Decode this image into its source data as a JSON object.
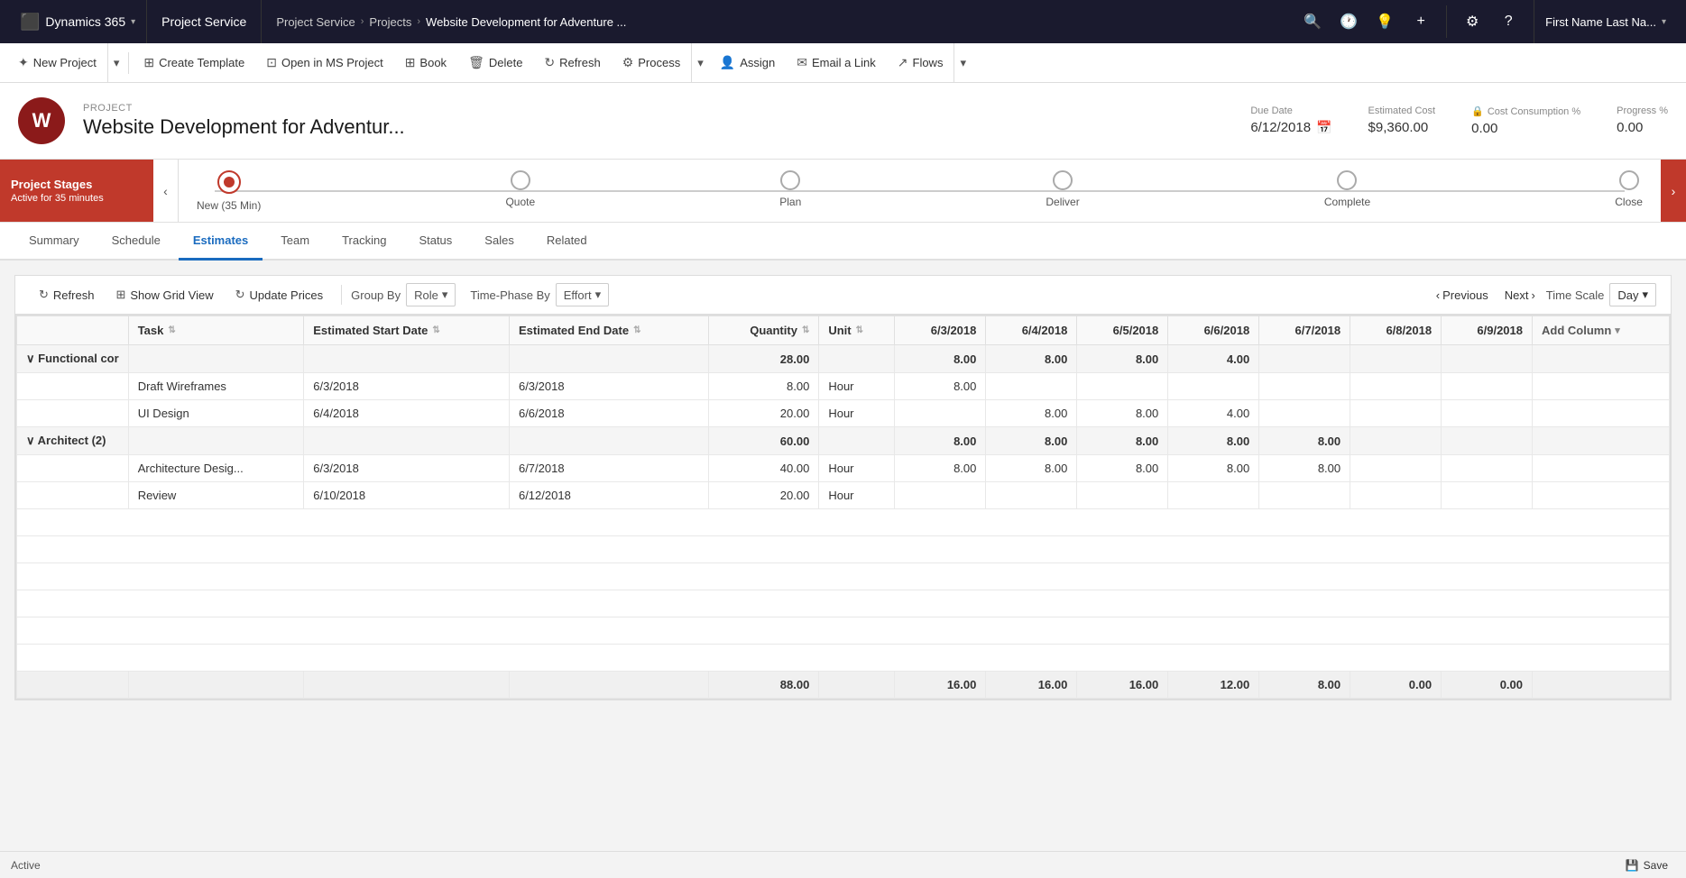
{
  "topnav": {
    "dynamics_label": "Dynamics 365",
    "module_label": "Project Service",
    "breadcrumb": [
      "Project Service",
      "Projects",
      "Website Development for Adventure ..."
    ],
    "user_label": "First Name Last Na...",
    "search_icon": "🔍",
    "recent_icon": "🕐",
    "nav_plus": "+",
    "settings_icon": "⚙",
    "help_icon": "?"
  },
  "commandbar": {
    "new_project_label": "New Project",
    "create_template_label": "Create Template",
    "open_ms_project_label": "Open in MS Project",
    "book_label": "Book",
    "delete_label": "Delete",
    "refresh_label": "Refresh",
    "process_label": "Process",
    "assign_label": "Assign",
    "email_link_label": "Email a Link",
    "flows_label": "Flows"
  },
  "project": {
    "label": "PROJECT",
    "title": "Website Development for Adventur...",
    "due_date_label": "Due Date",
    "due_date_value": "6/12/2018",
    "estimated_cost_label": "Estimated Cost",
    "estimated_cost_value": "$9,360.00",
    "cost_consumption_label": "Cost Consumption %",
    "cost_consumption_value": "0.00",
    "progress_label": "Progress %",
    "progress_value": "0.00",
    "icon_letter": "W"
  },
  "stages": {
    "label": "Project Stages",
    "sublabel": "Active for 35 minutes",
    "items": [
      {
        "name": "New (35 Min)",
        "active": true
      },
      {
        "name": "Quote",
        "active": false
      },
      {
        "name": "Plan",
        "active": false
      },
      {
        "name": "Deliver",
        "active": false
      },
      {
        "name": "Complete",
        "active": false
      },
      {
        "name": "Close",
        "active": false
      }
    ]
  },
  "tabs": {
    "items": [
      "Summary",
      "Schedule",
      "Estimates",
      "Team",
      "Tracking",
      "Status",
      "Sales",
      "Related"
    ],
    "active": "Estimates"
  },
  "estimates": {
    "toolbar": {
      "refresh_label": "Refresh",
      "show_grid_label": "Show Grid View",
      "update_prices_label": "Update Prices",
      "group_by_label": "Group By",
      "group_by_value": "Role",
      "time_phase_label": "Time-Phase By",
      "time_phase_value": "Effort",
      "previous_label": "Previous",
      "next_label": "Next",
      "timescale_label": "Time Scale",
      "timescale_value": "Day"
    },
    "columns": {
      "fixed": [
        "",
        "Task",
        "Estimated Start Date",
        "Estimated End Date",
        "Quantity",
        "Unit"
      ],
      "dates": [
        "6/3/2018",
        "6/4/2018",
        "6/5/2018",
        "6/6/2018",
        "6/7/2018",
        "6/8/2018",
        "6/9/2018"
      ],
      "add_col": "Add Column"
    },
    "groups": [
      {
        "name": "Functional cor",
        "total_quantity": "28.00",
        "date_values": [
          "8.00",
          "8.00",
          "8.00",
          "4.00",
          "",
          "",
          ""
        ],
        "rows": [
          {
            "task": "Draft Wireframes",
            "start": "6/3/2018",
            "end": "6/3/2018",
            "quantity": "8.00",
            "unit": "Hour",
            "date_values": [
              "8.00",
              "",
              "",
              "",
              "",
              "",
              ""
            ]
          },
          {
            "task": "UI Design",
            "start": "6/4/2018",
            "end": "6/6/2018",
            "quantity": "20.00",
            "unit": "Hour",
            "date_values": [
              "",
              "8.00",
              "8.00",
              "4.00",
              "",
              "",
              ""
            ]
          }
        ]
      },
      {
        "name": "Architect (2)",
        "total_quantity": "60.00",
        "date_values": [
          "8.00",
          "8.00",
          "8.00",
          "8.00",
          "8.00",
          "",
          ""
        ],
        "rows": [
          {
            "task": "Architecture Desig...",
            "start": "6/3/2018",
            "end": "6/7/2018",
            "quantity": "40.00",
            "unit": "Hour",
            "date_values": [
              "8.00",
              "8.00",
              "8.00",
              "8.00",
              "8.00",
              "",
              ""
            ]
          },
          {
            "task": "Review",
            "start": "6/10/2018",
            "end": "6/12/2018",
            "quantity": "20.00",
            "unit": "Hour",
            "date_values": [
              "",
              "",
              "",
              "",
              "",
              "",
              ""
            ]
          }
        ]
      }
    ],
    "footer": {
      "total_quantity": "88.00",
      "date_totals": [
        "16.00",
        "16.00",
        "16.00",
        "12.00",
        "8.00",
        "0.00",
        "0.00"
      ]
    }
  },
  "statusbar": {
    "status_label": "Active",
    "save_label": "Save"
  }
}
